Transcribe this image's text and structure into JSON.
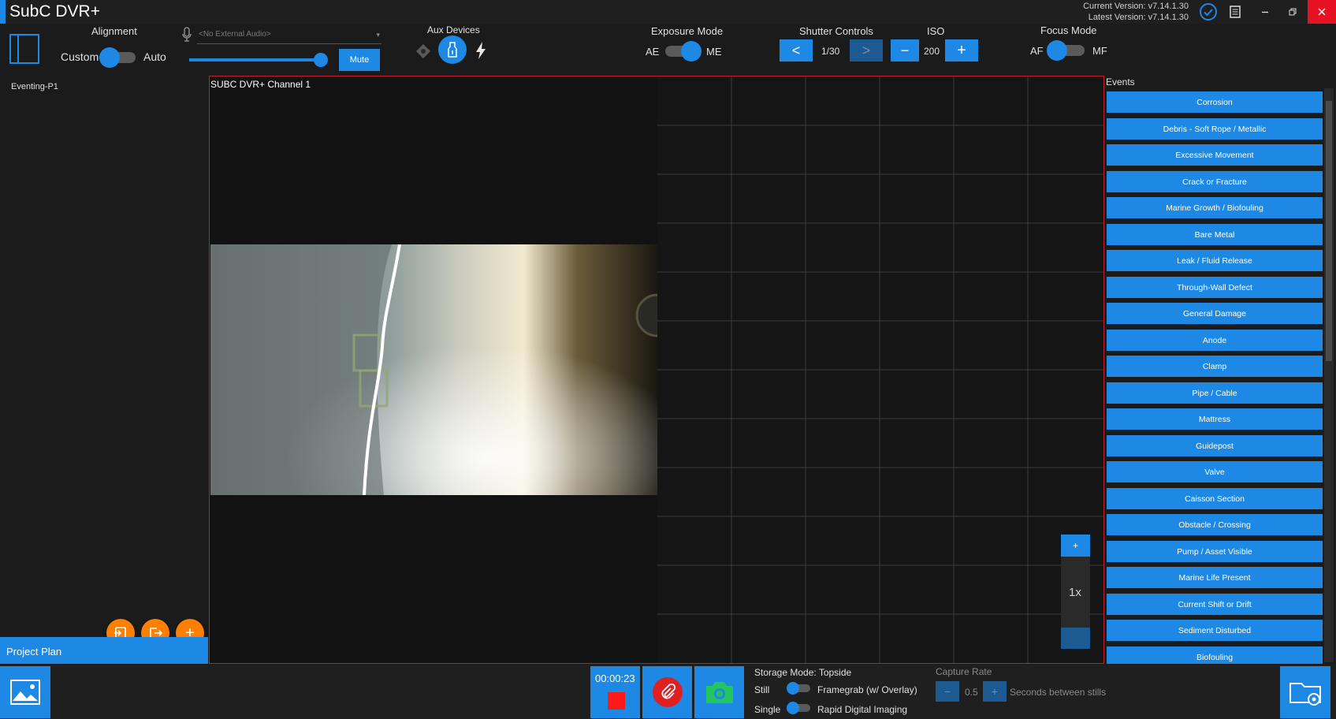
{
  "window": {
    "title": "SubC DVR+",
    "current_version": "Current Version: v7.14.1.30",
    "latest_version": "Latest Version: v7.14.1.30"
  },
  "toolbar": {
    "alignment_label": "Alignment",
    "custom_label": "Custom",
    "auto_label": "Auto",
    "audio_placeholder": "<No External Audio>",
    "mute_label": "Mute",
    "volume": 0.98,
    "aux_devices_label": "Aux Devices",
    "exposure_mode_label": "Exposure Mode",
    "ae_label": "AE",
    "me_label": "ME",
    "shutter_label": "Shutter Controls",
    "shutter_value": "1/30",
    "shutter_prev": "<",
    "shutter_next": ">",
    "iso_label": "ISO",
    "iso_minus": "−",
    "iso_value": "200",
    "iso_plus": "+",
    "focus_mode_label": "Focus Mode",
    "af_label": "AF",
    "mf_label": "MF"
  },
  "left_panel": {
    "project_item": "Eventing-P1",
    "project_plan_label": "Project Plan",
    "add_button": "+"
  },
  "video": {
    "channel_label": "SUBC DVR+ Channel 1",
    "zoom_plus": "+",
    "zoom_level": "1x"
  },
  "events": {
    "title": "Events",
    "items": [
      "Corrosion",
      "Debris - Soft Rope / Metallic",
      "Excessive Movement",
      "Crack or Fracture",
      "Marine Growth / Biofouling",
      "Bare Metal",
      "Leak / Fluid Release",
      "Through-Wall Defect",
      "General Damage",
      "Anode",
      "Clamp",
      "Pipe / Cable",
      "Mattress",
      "Guidepost",
      "Valve",
      "Caisson Section",
      "Obstacle / Crossing",
      "Pump / Asset Visible",
      "Marine Life Present",
      "Current Shift or Drift",
      "Sediment Disturbed",
      "Biofouling"
    ]
  },
  "bottom": {
    "record_time": "00:00:23",
    "storage_mode": "Storage Mode: Topside",
    "still_label": "Still",
    "framegrab_label": "Framegrab (w/ Overlay)",
    "single_label": "Single",
    "rapid_label": "Rapid Digital Imaging",
    "capture_rate_label": "Capture Rate",
    "capture_rate_minus": "−",
    "capture_rate_value": "0.5",
    "capture_rate_plus": "+",
    "seconds_label": "Seconds between stills"
  },
  "colors": {
    "accent": "#1e88e5",
    "orange": "#ff7f00",
    "record_red": "#ff1a1a",
    "capture_green": "#22c55e",
    "frame_red": "#c0202a"
  }
}
